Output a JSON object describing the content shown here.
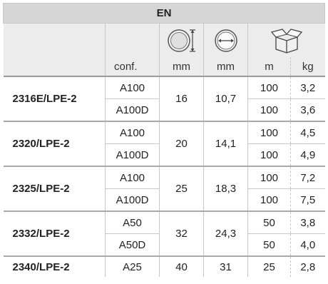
{
  "header": {
    "title": "EN",
    "units": {
      "conf": "conf.",
      "outer_diameter": "mm",
      "inner_diameter": "mm",
      "length": "m",
      "weight": "kg"
    },
    "icons": [
      "outer-diameter-icon",
      "inner-diameter-icon",
      "package-box-icon"
    ]
  },
  "rows": [
    {
      "code": "2316E/LPE-2",
      "outer": "16",
      "inner": "10,7",
      "variants": [
        {
          "conf": "A100",
          "m": "100",
          "kg": "3,2"
        },
        {
          "conf": "A100D",
          "m": "100",
          "kg": "3,6"
        }
      ]
    },
    {
      "code": "2320/LPE-2",
      "outer": "20",
      "inner": "14,1",
      "variants": [
        {
          "conf": "A100",
          "m": "100",
          "kg": "4,5"
        },
        {
          "conf": "A100D",
          "m": "100",
          "kg": "4,9"
        }
      ]
    },
    {
      "code": "2325/LPE-2",
      "outer": "25",
      "inner": "18,3",
      "variants": [
        {
          "conf": "A100",
          "m": "100",
          "kg": "7,2"
        },
        {
          "conf": "A100D",
          "m": "100",
          "kg": "7,5"
        }
      ]
    },
    {
      "code": "2332/LPE-2",
      "outer": "32",
      "inner": "24,3",
      "variants": [
        {
          "conf": "A50",
          "m": "50",
          "kg": "3,8"
        },
        {
          "conf": "A50D",
          "m": "50",
          "kg": "4,0"
        }
      ]
    },
    {
      "code": "2340/LPE-2",
      "outer": "40",
      "inner": "31",
      "variants": [
        {
          "conf": "A25",
          "m": "25",
          "kg": "2,8"
        }
      ]
    }
  ]
}
